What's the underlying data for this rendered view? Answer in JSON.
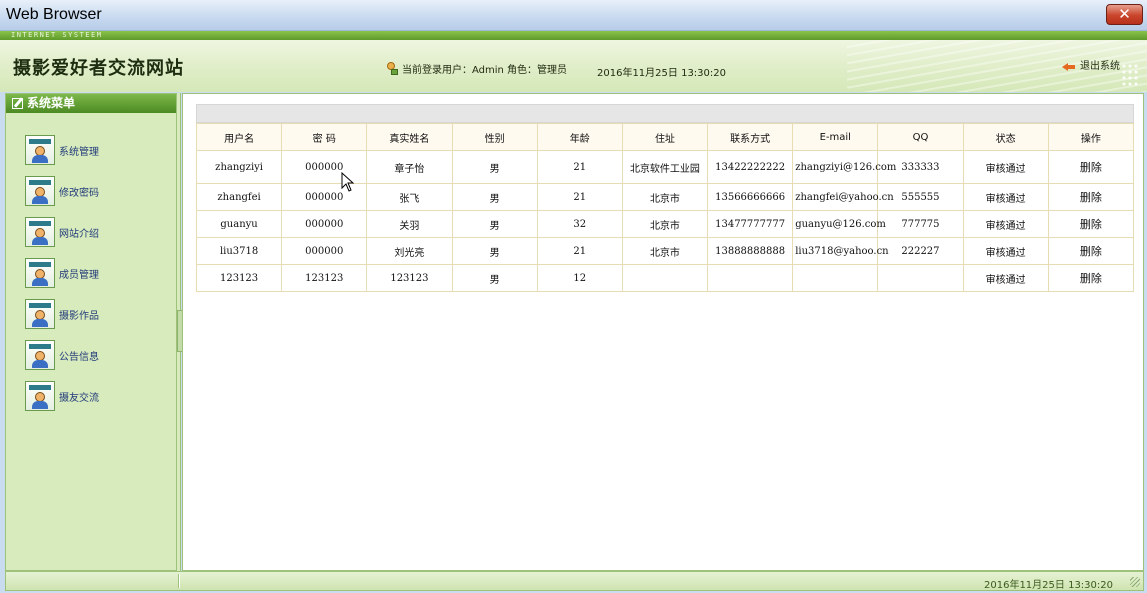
{
  "window": {
    "title": "Web Browser",
    "close_label": "✕"
  },
  "header": {
    "subtitle": "INTERNET SYSTEEM",
    "site_title": "摄影爱好者交流网站",
    "user_info": "当前登录用户：Admin 角色：管理员",
    "datetime": "2016年11月25日 13:30:20",
    "logout_label": "退出系统",
    "user_icon": "user-key-icon",
    "logout_icon": "logout-arrow-icon"
  },
  "sidebar": {
    "title": "系统菜单",
    "items": [
      {
        "label": "系统管理",
        "icon": "admin-user-icon"
      },
      {
        "label": "修改密码",
        "icon": "admin-user-icon"
      },
      {
        "label": "网站介绍",
        "icon": "admin-user-icon"
      },
      {
        "label": "成员管理",
        "icon": "admin-user-icon"
      },
      {
        "label": "摄影作品",
        "icon": "admin-user-icon"
      },
      {
        "label": "公告信息",
        "icon": "admin-user-icon"
      },
      {
        "label": "摄友交流",
        "icon": "admin-user-icon"
      }
    ]
  },
  "table": {
    "headers": [
      "用户名",
      "密  码",
      "真实姓名",
      "性别",
      "年龄",
      "住址",
      "联系方式",
      "E-mail",
      "QQ",
      "状态",
      "操作"
    ],
    "rows": [
      [
        "zhangziyi",
        "000000",
        "章子怡",
        "男",
        "21",
        "北京软件工业园",
        "13422222222",
        "zhangziyi@126.com",
        "333333",
        "审核通过",
        "删除"
      ],
      [
        "zhangfei",
        "000000",
        "张飞",
        "男",
        "21",
        "北京市",
        "13566666666",
        "zhangfei@yahoo.cn",
        "555555",
        "审核通过",
        "删除"
      ],
      [
        "guanyu",
        "000000",
        "关羽",
        "男",
        "32",
        "北京市",
        "13477777777",
        "guanyu@126.com",
        "777775",
        "审核通过",
        "删除"
      ],
      [
        "liu3718",
        "000000",
        "刘光亮",
        "男",
        "21",
        "北京市",
        "13888888888",
        "liu3718@yahoo.cn",
        "222227",
        "审核通过",
        "删除"
      ],
      [
        "123123",
        "123123",
        "123123",
        "男",
        "12",
        "",
        "",
        "",
        "",
        "审核通过",
        "删除"
      ]
    ]
  },
  "statusbar": {
    "datetime": "2016年11月25日 13:30:20"
  },
  "colors": {
    "accent_green": "#5f9a2a",
    "sidebar_bg": "#d7ebbd",
    "menu_text": "#233b7a"
  }
}
